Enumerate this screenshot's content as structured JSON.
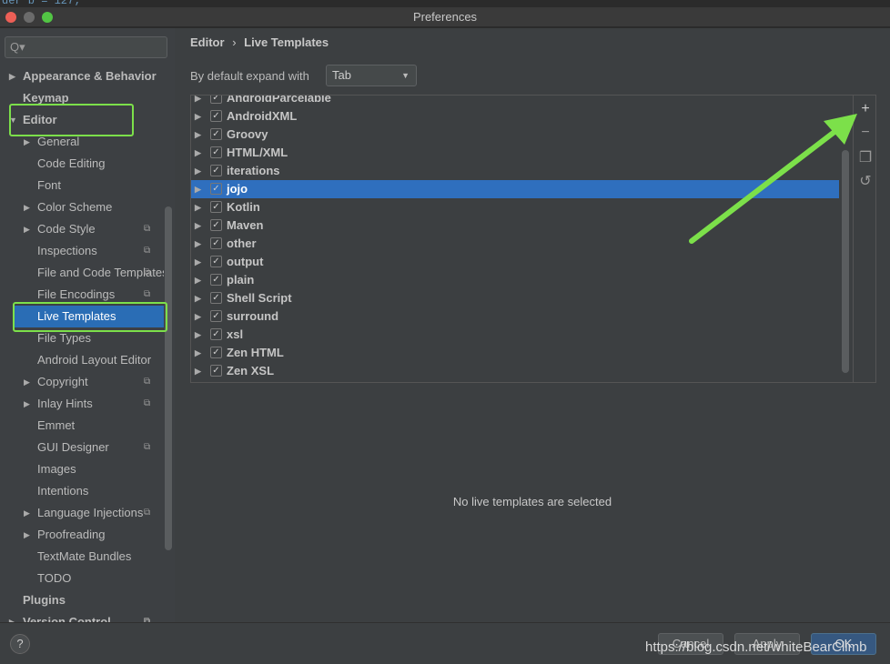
{
  "window": {
    "title": "Preferences",
    "code_fragment": "der b = 127;"
  },
  "sidebar": {
    "search_placeholder": "Q▾",
    "items": [
      {
        "label": "Appearance & Behavior",
        "level": 0,
        "bold": true,
        "arrow": "▶"
      },
      {
        "label": "Keymap",
        "level": 0,
        "bold": true,
        "arrow": ""
      },
      {
        "label": "Editor",
        "level": 0,
        "bold": true,
        "arrow": "▼"
      },
      {
        "label": "General",
        "level": 1,
        "arrow": "▶"
      },
      {
        "label": "Code Editing",
        "level": 1,
        "arrow": ""
      },
      {
        "label": "Font",
        "level": 1,
        "arrow": ""
      },
      {
        "label": "Color Scheme",
        "level": 1,
        "arrow": "▶"
      },
      {
        "label": "Code Style",
        "level": 1,
        "arrow": "▶",
        "cfg": true
      },
      {
        "label": "Inspections",
        "level": 1,
        "arrow": "",
        "cfg": true
      },
      {
        "label": "File and Code Templates",
        "level": 1,
        "arrow": "",
        "cfg": true
      },
      {
        "label": "File Encodings",
        "level": 1,
        "arrow": "",
        "cfg": true
      },
      {
        "label": "Live Templates",
        "level": 1,
        "arrow": "",
        "selected": true
      },
      {
        "label": "File Types",
        "level": 1,
        "arrow": ""
      },
      {
        "label": "Android Layout Editor",
        "level": 1,
        "arrow": ""
      },
      {
        "label": "Copyright",
        "level": 1,
        "arrow": "▶",
        "cfg": true
      },
      {
        "label": "Inlay Hints",
        "level": 1,
        "arrow": "▶",
        "cfg": true
      },
      {
        "label": "Emmet",
        "level": 1,
        "arrow": ""
      },
      {
        "label": "GUI Designer",
        "level": 1,
        "arrow": "",
        "cfg": true
      },
      {
        "label": "Images",
        "level": 1,
        "arrow": ""
      },
      {
        "label": "Intentions",
        "level": 1,
        "arrow": ""
      },
      {
        "label": "Language Injections",
        "level": 1,
        "arrow": "▶",
        "cfg": true
      },
      {
        "label": "Proofreading",
        "level": 1,
        "arrow": "▶"
      },
      {
        "label": "TextMate Bundles",
        "level": 1,
        "arrow": ""
      },
      {
        "label": "TODO",
        "level": 1,
        "arrow": ""
      },
      {
        "label": "Plugins",
        "level": 0,
        "bold": true,
        "arrow": ""
      },
      {
        "label": "Version Control",
        "level": 0,
        "bold": true,
        "arrow": "▶",
        "cfg": true
      }
    ]
  },
  "main": {
    "breadcrumb": [
      "Editor",
      "Live Templates"
    ],
    "breadcrumb_sep": "›",
    "expand_label": "By default expand with",
    "expand_value": "Tab",
    "templates": [
      {
        "name": "AndroidParcelable",
        "checked": true
      },
      {
        "name": "AndroidXML",
        "checked": true
      },
      {
        "name": "Groovy",
        "checked": true
      },
      {
        "name": "HTML/XML",
        "checked": true
      },
      {
        "name": "iterations",
        "checked": true
      },
      {
        "name": "jojo",
        "checked": true,
        "selected": true
      },
      {
        "name": "Kotlin",
        "checked": true
      },
      {
        "name": "Maven",
        "checked": true
      },
      {
        "name": "other",
        "checked": true
      },
      {
        "name": "output",
        "checked": true
      },
      {
        "name": "plain",
        "checked": true
      },
      {
        "name": "Shell Script",
        "checked": true
      },
      {
        "name": "surround",
        "checked": true
      },
      {
        "name": "xsl",
        "checked": true
      },
      {
        "name": "Zen HTML",
        "checked": true
      },
      {
        "name": "Zen XSL",
        "checked": true
      }
    ],
    "tools": [
      {
        "name": "add",
        "glyph": "+"
      },
      {
        "name": "remove",
        "glyph": "−"
      },
      {
        "name": "copy",
        "glyph": "❐"
      },
      {
        "name": "restore",
        "glyph": "↺"
      }
    ],
    "empty_message": "No live templates are selected"
  },
  "footer": {
    "help": "?",
    "cancel": "Cancel",
    "apply": "Apply",
    "ok": "OK",
    "watermark": "https://blog.csdn.net/whiteBearClimb"
  },
  "colors": {
    "selection": "#2f6fbe",
    "highlight": "#7ce04a",
    "arrow_annotation": "#7ce04a"
  }
}
